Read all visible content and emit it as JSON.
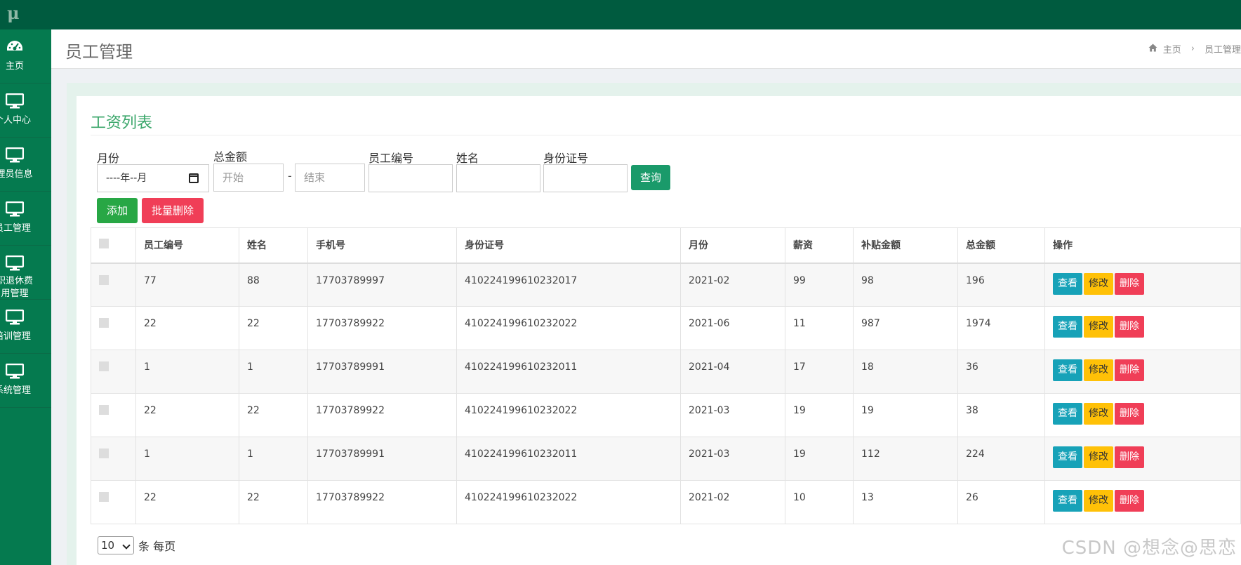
{
  "logo": "μ",
  "sidebar": {
    "items": [
      {
        "label": "主页",
        "icon": "dashboard-icon"
      },
      {
        "label": "个人中心",
        "icon": "monitor-icon"
      },
      {
        "label": "管理员信息",
        "icon": "monitor-icon"
      },
      {
        "label": "员工管理",
        "icon": "monitor-icon"
      },
      {
        "label": "职退休费用管理",
        "icon": "monitor-icon"
      },
      {
        "label": "培训管理",
        "icon": "monitor-icon"
      },
      {
        "label": "系统管理",
        "icon": "monitor-icon"
      }
    ]
  },
  "header": {
    "title": "员工管理",
    "breadcrumb": {
      "home": "主页",
      "current": "员工管理"
    }
  },
  "panel": {
    "title": "工资列表"
  },
  "filters": {
    "month_label": "月份",
    "month_placeholder": "----年--月",
    "total_label": "总金额",
    "total_start_placeholder": "开始",
    "total_dash": "-",
    "total_end_placeholder": "结束",
    "emp_no_label": "员工编号",
    "name_label": "姓名",
    "id_label": "身份证号",
    "query_button": "查询"
  },
  "actions": {
    "add_button": "添加",
    "batch_delete_button": "批量删除"
  },
  "table": {
    "headers": [
      "员工编号",
      "姓名",
      "手机号",
      "身份证号",
      "月份",
      "薪资",
      "补贴金额",
      "总金额",
      "操作"
    ],
    "rows": [
      [
        "77",
        "88",
        "17703789997",
        "410224199610232017",
        "2021-02",
        "99",
        "98",
        "196"
      ],
      [
        "22",
        "22",
        "17703789922",
        "410224199610232022",
        "2021-06",
        "11",
        "987",
        "1974"
      ],
      [
        "1",
        "1",
        "17703789991",
        "410224199610232011",
        "2021-04",
        "17",
        "18",
        "36"
      ],
      [
        "22",
        "22",
        "17703789922",
        "410224199610232022",
        "2021-03",
        "19",
        "19",
        "38"
      ],
      [
        "1",
        "1",
        "17703789991",
        "410224199610232011",
        "2021-03",
        "19",
        "112",
        "224"
      ],
      [
        "22",
        "22",
        "17703789922",
        "410224199610232022",
        "2021-02",
        "10",
        "13",
        "26"
      ]
    ],
    "row_actions": {
      "view": "查看",
      "edit": "修改",
      "delete": "删除"
    }
  },
  "pager": {
    "page_size": "10",
    "suffix": "条 每页"
  },
  "watermark": "CSDN @想念@思恋",
  "colors": {
    "topbar": "#005b3f",
    "sidebar": "#057a4f",
    "accent": "#3aa66a",
    "danger": "#f03e57",
    "warning": "#ffc107",
    "info": "#17a2b8"
  }
}
